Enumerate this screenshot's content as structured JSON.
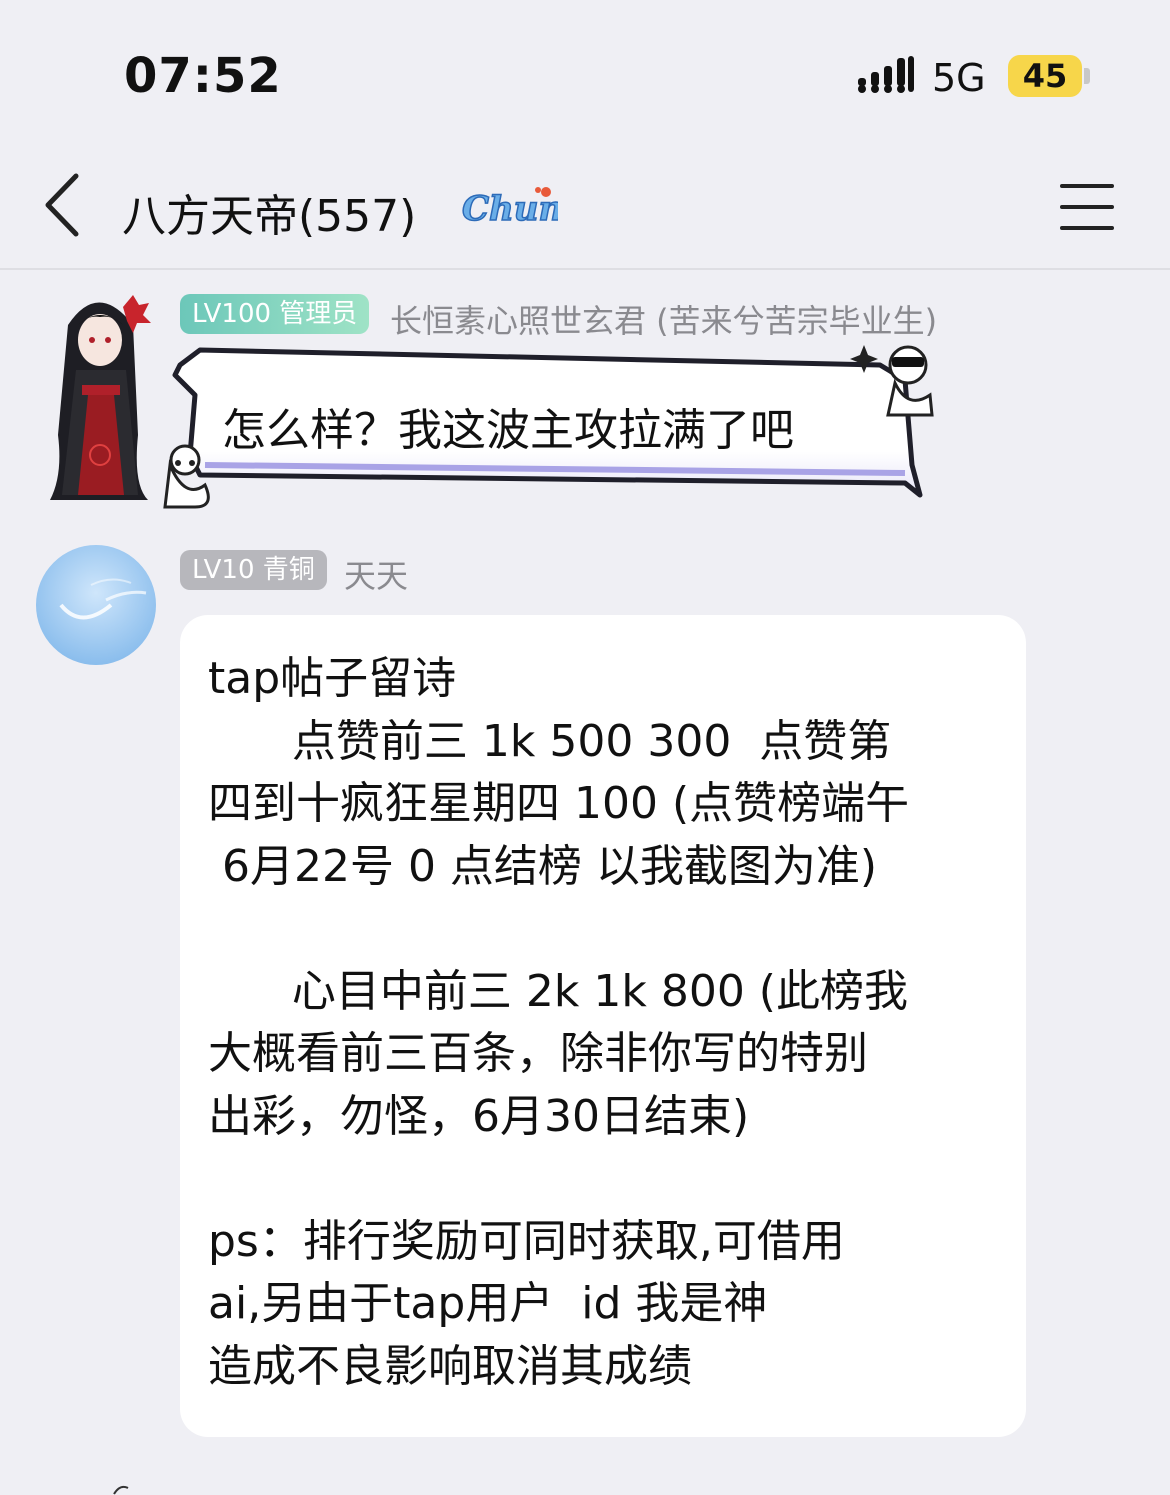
{
  "status_bar": {
    "time": "07:52",
    "network": "5G",
    "battery": "45",
    "battery_color": "#f7d64a"
  },
  "header": {
    "title": "八方天帝(557)",
    "badge_text": "Chun",
    "back_icon": "chevron-left-icon",
    "menu_icon": "hamburger-menu-icon"
  },
  "messages": [
    {
      "level_badge": "LV100 管理员",
      "sender": "长恒素心照世玄君 (苦来兮苦宗毕业生)",
      "text": "怎么样？我这波主攻拉满了吧"
    },
    {
      "level_badge": "LV10 青铜",
      "sender": "天天",
      "text": "tap帖子留诗\n      点赞前三 1k 500 300  点赞第\n四到十疯狂星期四 100 (点赞榜端午\n 6月22号 0 点结榜 以我截图为准)\n\n      心目中前三 2k 1k 800 (此榜我\n大概看前三百条，除非你写的特别\n出彩，勿怪，6月30日结束)\n\nps：排行奖励可同时获取,可借用\nai,另由于tap用户  id 我是神\n造成不良影响取消其成绩"
    }
  ]
}
